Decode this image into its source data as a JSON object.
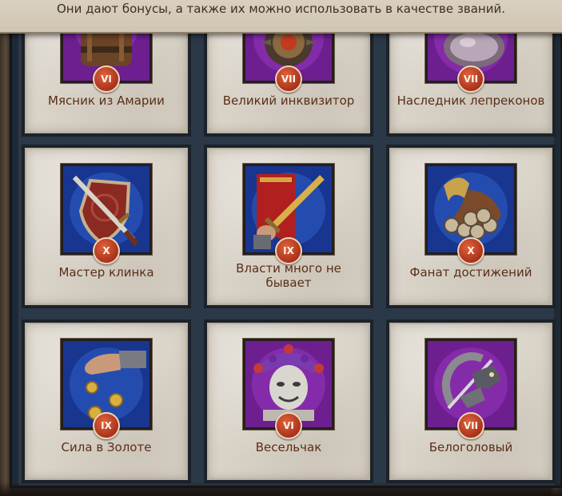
{
  "header": {
    "description": "Они дают бонусы, а также их можно использовать в качестве званий."
  },
  "achievements": [
    {
      "title": "Мясник из Амарии",
      "rank": "VI",
      "icon": "butcher-icon",
      "bg": "#7a1fa0"
    },
    {
      "title": "Великий инквизитор",
      "rank": "VII",
      "icon": "inquisitor-icon",
      "bg": "#7a1fa0"
    },
    {
      "title": "Наследник лепреконов",
      "rank": "VII",
      "icon": "leprechaun-icon",
      "bg": "#7a1fa0"
    },
    {
      "title": "Мастер клинка",
      "rank": "X",
      "icon": "sword-shield-icon",
      "bg": "#1a3fa0"
    },
    {
      "title": "Власти много не бывает",
      "rank": "IX",
      "icon": "sword-banner-icon",
      "bg": "#1a3fa0"
    },
    {
      "title": "Фанат достижений",
      "rank": "X",
      "icon": "coins-horn-icon",
      "bg": "#1a3fa0"
    },
    {
      "title": "Сила в Золоте",
      "rank": "IX",
      "icon": "gold-hand-icon",
      "bg": "#1a3fa0"
    },
    {
      "title": "Весельчак",
      "rank": "VI",
      "icon": "jester-mask-icon",
      "bg": "#7a1fa0"
    },
    {
      "title": "Белоголовый",
      "rank": "VII",
      "icon": "dragon-seal-icon",
      "bg": "#7a1fa0"
    }
  ]
}
